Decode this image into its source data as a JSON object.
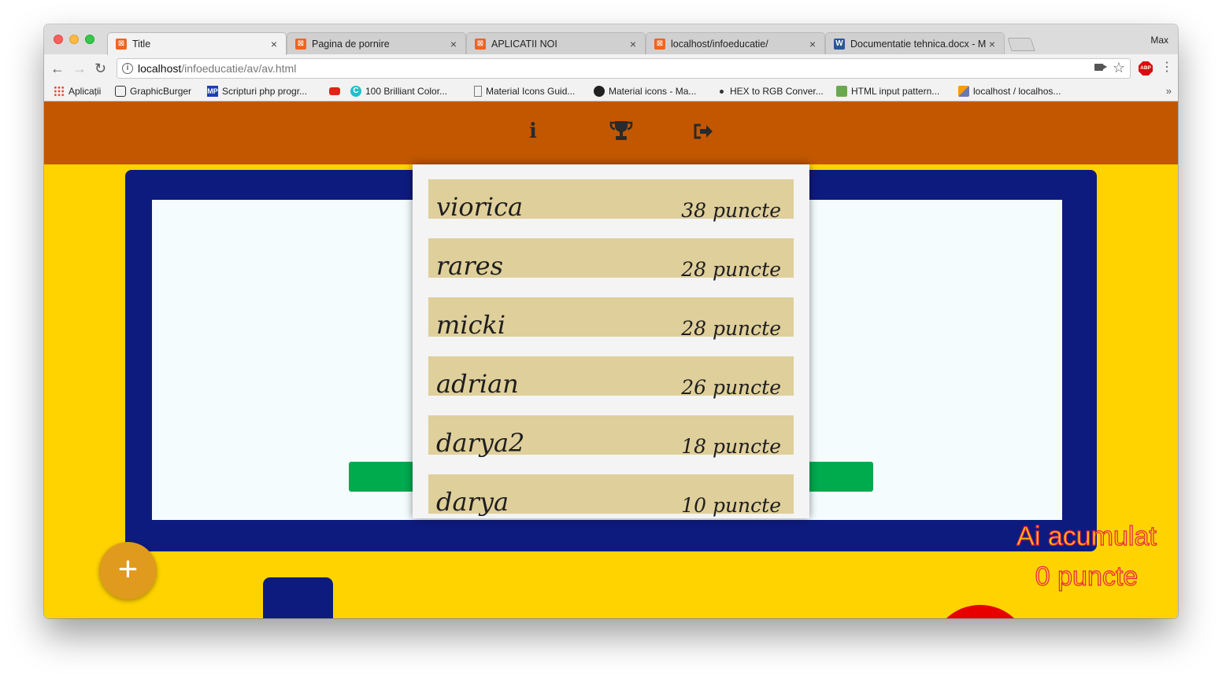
{
  "browser": {
    "profile_name": "Max",
    "tabs": [
      {
        "label": "Title",
        "active": true,
        "favicon": "xampp-icon"
      },
      {
        "label": "Pagina de pornire",
        "active": false,
        "favicon": "xampp-icon"
      },
      {
        "label": "APLICATII NOI",
        "active": false,
        "favicon": "xampp-icon"
      },
      {
        "label": "localhost/infoeducatie/",
        "active": false,
        "favicon": "xampp-icon"
      },
      {
        "label": "Documentatie tehnica.docx - M",
        "active": false,
        "favicon": "word-icon"
      }
    ],
    "url_host": "localhost",
    "url_path": "/infoeducatie/av/av.html",
    "bookmarks": [
      {
        "label": "Aplicații",
        "icon": "apps-grid-icon"
      },
      {
        "label": "GraphicBurger",
        "icon": "graphicburger-icon"
      },
      {
        "label": "Scripturi php progr...",
        "icon": "mp-icon"
      },
      {
        "label": "",
        "icon": "youtube-icon"
      },
      {
        "label": "100 Brilliant Color...",
        "icon": "canva-icon"
      },
      {
        "label": "Material Icons Guid...",
        "icon": "page-icon"
      },
      {
        "label": "Material icons - Ma...",
        "icon": "github-icon"
      },
      {
        "label": "HEX to RGB Conver...",
        "icon": "dot-icon"
      },
      {
        "label": "HTML input pattern...",
        "icon": "html-pattern-icon"
      },
      {
        "label": "localhost / localhos...",
        "icon": "phpmyadmin-icon"
      }
    ]
  },
  "app": {
    "nav_icons": [
      "info-icon",
      "trophy-icon",
      "logout-icon"
    ],
    "leaderboard": [
      {
        "name": "viorica",
        "score": "38 puncte"
      },
      {
        "name": "rares",
        "score": "28 puncte"
      },
      {
        "name": "micki",
        "score": "28 puncte"
      },
      {
        "name": "adrian",
        "score": "26 puncte"
      },
      {
        "name": "darya2",
        "score": "18 puncte"
      },
      {
        "name": "darya",
        "score": "10 puncte"
      }
    ],
    "score_line1": "Ai acumulat",
    "score_line2": "0 puncte",
    "fab_label": "+",
    "colors": {
      "appbar": "#c25700",
      "page_background": "#ffd300",
      "board": "#0e1b7e",
      "leaderboard_row": "#dfcf9b",
      "green_button": "#00ab4e",
      "fab": "#e09a1e",
      "score_text_outline": "#e8204a"
    }
  }
}
